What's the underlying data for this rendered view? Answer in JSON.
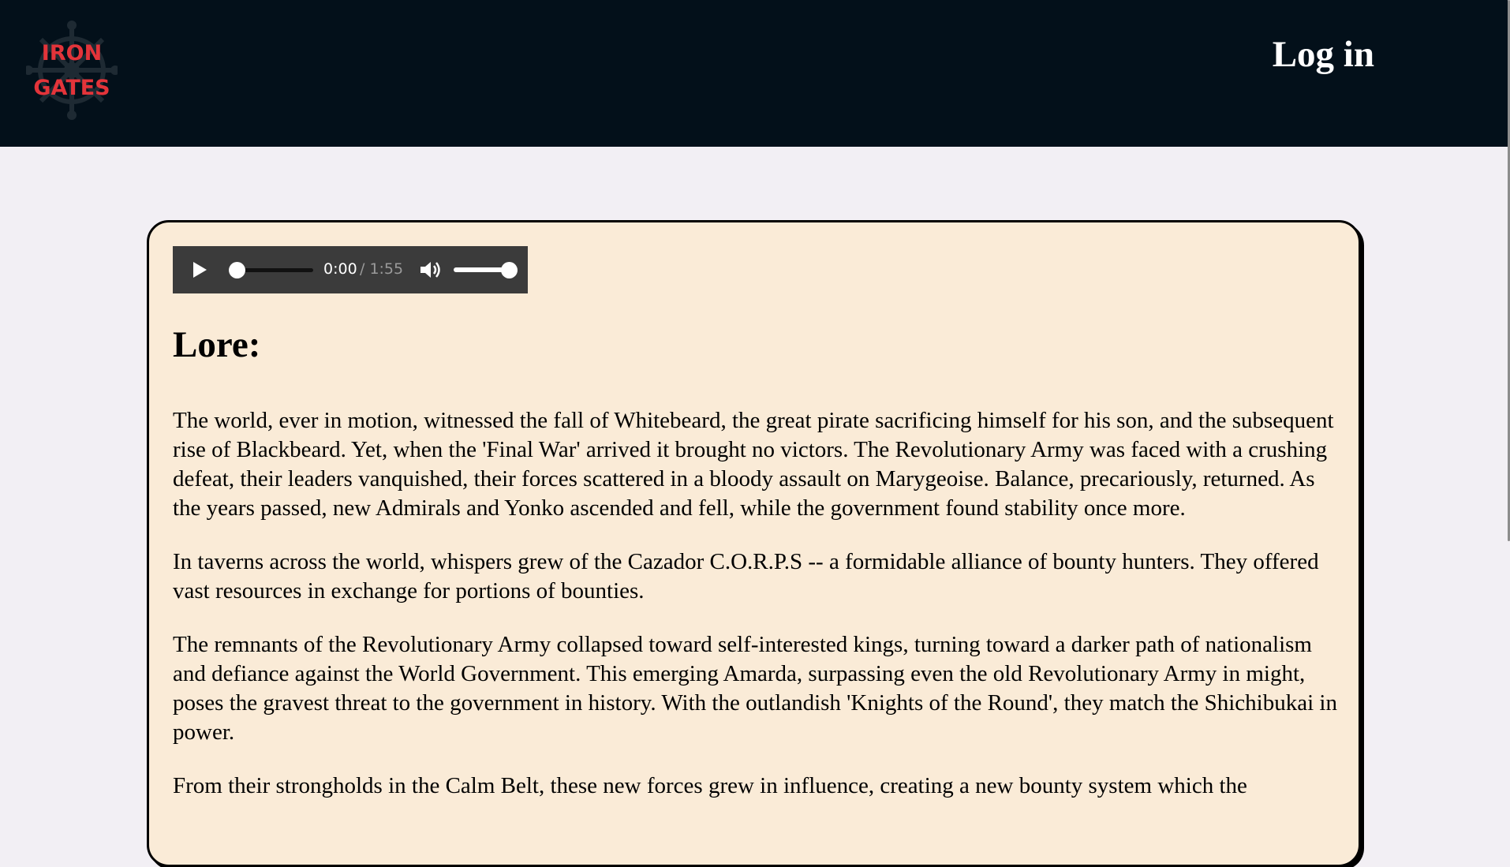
{
  "header": {
    "logo": {
      "line1": "IRON",
      "line2": "GATES",
      "icon": "ship-wheel-icon"
    },
    "login_label": "Log in"
  },
  "audio_player": {
    "current_time": "0:00",
    "total_time": "/ 1:55",
    "progress": 0,
    "volume": 1.0,
    "play_icon": "play-icon",
    "volume_icon": "volume-icon"
  },
  "lore": {
    "title": "Lore:",
    "paragraphs": [
      "The world, ever in motion, witnessed the fall of Whitebeard, the great pirate sacrificing himself for his son, and the subsequent rise of Blackbeard. Yet, when the 'Final War' arrived it brought no victors. The Revolutionary Army was faced with a crushing defeat, their leaders vanquished, their forces scattered in a bloody assault on Marygeoise. Balance, precariously, returned. As the years passed, new Admirals and Yonko ascended and fell, while the government found stability once more.",
      "In taverns across the world, whispers grew of the Cazador C.O.R.P.S -- a formidable alliance of bounty hunters. They offered vast resources in exchange for portions of bounties.",
      "The remnants of the Revolutionary Army collapsed toward self-interested kings, turning toward a darker path of nationalism and defiance against the World Government. This emerging Amarda, surpassing even the old Revolutionary Army in might, poses the gravest threat to the government in history. With the outlandish 'Knights of the Round', they match the Shichibukai in power.",
      "From their strongholds in the Calm Belt, these new forces grew in influence, creating a new bounty system which the"
    ]
  },
  "colors": {
    "header_bg": "#03101a",
    "page_bg": "#f2eff4",
    "card_bg": "#faebd7",
    "logo_text": "#e3343a",
    "player_bg": "#3b3b3b"
  }
}
